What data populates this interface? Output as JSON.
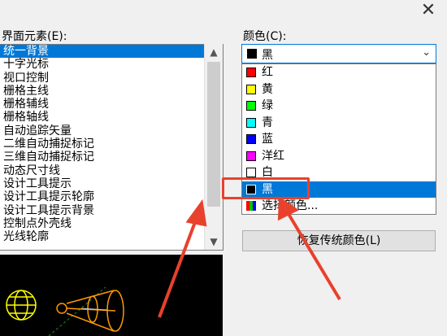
{
  "dialog": {
    "close_glyph": "✕"
  },
  "elements": {
    "label": "界面元素(E):",
    "items": [
      "统一背景",
      "十字光标",
      "视口控制",
      "栅格主线",
      "栅格辅线",
      "栅格轴线",
      "自动追踪矢量",
      "二维自动捕捉标记",
      "三维自动捕捉标记",
      "动态尺寸线",
      "设计工具提示",
      "设计工具提示轮廓",
      "设计工具提示背景",
      "控制点外壳线",
      "光线轮廓"
    ],
    "selected_index": 0
  },
  "color": {
    "label": "颜色(C):",
    "selected": "黑",
    "options": [
      {
        "name": "红",
        "swatch": "#ff0000"
      },
      {
        "name": "黄",
        "swatch": "#ffff00"
      },
      {
        "name": "绿",
        "swatch": "#00ff00"
      },
      {
        "name": "青",
        "swatch": "#00ffff"
      },
      {
        "name": "蓝",
        "swatch": "#0000ff"
      },
      {
        "name": "洋红",
        "swatch": "#ff00ff"
      },
      {
        "name": "白",
        "swatch": "#ffffff"
      },
      {
        "name": "黑",
        "swatch": "#000000"
      },
      {
        "name": "选择颜色...",
        "swatch": "multicolor-grid-icon"
      }
    ],
    "highlighted_index": 7
  },
  "buttons": {
    "restore": "恢复传统颜色(L)"
  },
  "accent_colors": {
    "selection": "#0078d7",
    "annotation": "#e8412c"
  }
}
